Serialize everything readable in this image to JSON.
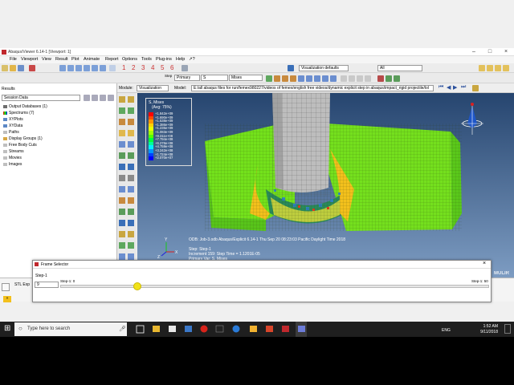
{
  "window": {
    "title": "Abaqus/Viewer 6.14-1 [Viewport: 1]"
  },
  "menu": [
    "File",
    "Viewport",
    "View",
    "Result",
    "Plot",
    "Animate",
    "Report",
    "Options",
    "Tools",
    "Plug-ins",
    "Help",
    "↗?"
  ],
  "toolbar": {
    "step_label": "Step",
    "frame_label": "Frame",
    "primary": "Primary",
    "variable": "S",
    "invariant": "Mises",
    "view_defaults": "Visualization defaults",
    "all": "All",
    "numbers": [
      "1",
      "2",
      "3",
      "4",
      "5",
      "6"
    ]
  },
  "context": {
    "module_label": "Module:",
    "module_value": "Visualization",
    "model_label": "Model:",
    "model_value": "E:/all abaqus files for run/femex980227/videos of femex/english free videos/dynamic explicit step in abaqus/impact_rigid projectile/lol"
  },
  "left_panel": {
    "tab": "Results",
    "selector": "Session Data",
    "tree": [
      {
        "label": "Output Databases (1)",
        "icon": "database-icon"
      },
      {
        "label": "Spectrums (7)",
        "icon": "spectrum-icon"
      },
      {
        "label": "XYPlots",
        "icon": "xyplot-icon"
      },
      {
        "label": "XYData",
        "icon": "xydata-icon"
      },
      {
        "label": "Paths",
        "icon": "path-icon"
      },
      {
        "label": "Display Groups (1)",
        "icon": "display-group-icon"
      },
      {
        "label": "Free Body Cuts",
        "icon": "free-body-icon"
      },
      {
        "label": "Streams",
        "icon": "stream-icon"
      },
      {
        "label": "Movies",
        "icon": "movie-icon"
      },
      {
        "label": "Images",
        "icon": "image-icon"
      }
    ]
  },
  "legend": {
    "title": "S, Mises",
    "subtitle": "(Avg: 75%)",
    "values": [
      "+1.842e+09",
      "+1.690e+09",
      "+1.538e+09",
      "+1.386e+09",
      "+1.235e+09",
      "+1.083e+09",
      "+9.311e+08",
      "+7.794e+08",
      "+6.276e+08",
      "+4.759e+08",
      "+3.242e+08",
      "+1.724e+08",
      "+2.070e+07"
    ],
    "colors": [
      "#ff0000",
      "#ff4a00",
      "#ff9400",
      "#ffd200",
      "#e6ff00",
      "#a0ff00",
      "#52ff00",
      "#00ff3c",
      "#00ff98",
      "#00f0ff",
      "#0096ff",
      "#0040ff",
      "#0000ff"
    ]
  },
  "info": {
    "odb_line": "ODB: Job-3.odb    Abaqus/Explicit 6.14-1    Thu Sep 20 08:23:03 Pacific Daylight Time 2018",
    "step_line": "Step: Step-1",
    "increment_line": "Increment      159: Step Time =    1.1201E-05",
    "primary_line": "Primary Var: S, Mises"
  },
  "frame_selector": {
    "title": "Frame Selector",
    "step": "Step-1",
    "value": "9",
    "left_label": "Step-1: 0",
    "right_label": "Step-1: 50",
    "position_fraction": 0.18
  },
  "message": {
    "text": "STL  Exp"
  },
  "watermark": "MULIR",
  "taskbar": {
    "search_placeholder": "Type here to search",
    "language": "ENG",
    "time": "1:52 AM",
    "date": "9/11/2018"
  }
}
